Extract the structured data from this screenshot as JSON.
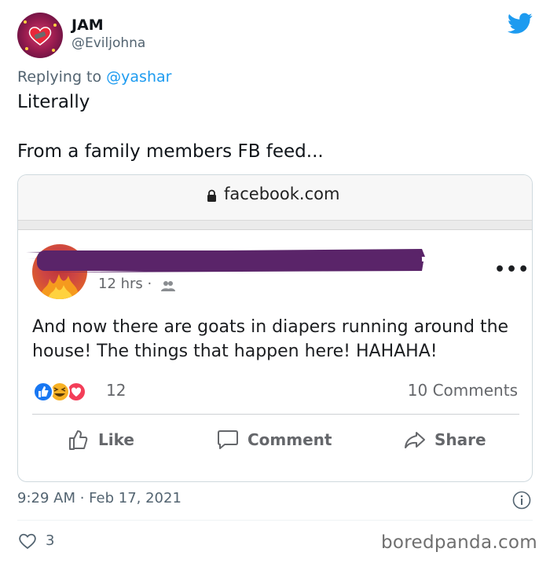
{
  "tweet": {
    "name": "JAM",
    "handle": "@Eviljohna",
    "replying_prefix": "Replying to ",
    "replying_mention": "@yashar",
    "text_line1": "Literally",
    "text_line2": "From a family members FB feed...",
    "timestamp": "9:29 AM · Feb 17, 2021",
    "like_count": "3",
    "watermark": "boredpanda.com"
  },
  "screenshot": {
    "url": "facebook.com",
    "post_meta": "12 hrs ·",
    "more_label": "•••",
    "post_text": "And now there are goats in diapers running around the house! The things that happen here! HAHAHA!",
    "reaction_count": "12",
    "comments_count": "10 Comments",
    "actions": {
      "like": "Like",
      "comment": "Comment",
      "share": "Share"
    }
  },
  "icons": {
    "bird": "twitter-bird-icon",
    "lock": "lock-icon",
    "friends": "friends-icon",
    "info": "info-icon",
    "heart": "heart-icon"
  },
  "colors": {
    "twitter_blue": "#1d9bf0",
    "redaction": "#5a2469",
    "fb_gray": "#65676b"
  }
}
